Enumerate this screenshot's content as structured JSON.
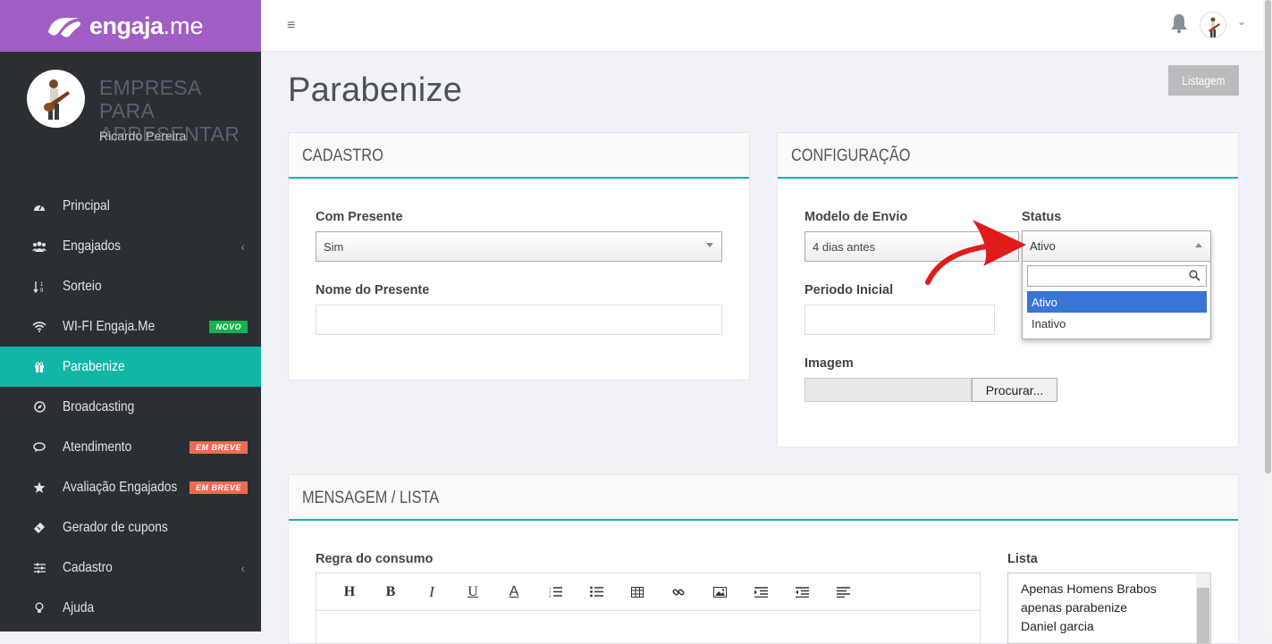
{
  "brand": {
    "name_bold": "engaja",
    "name_rest": ".me",
    "color": "#a05ec5"
  },
  "profile": {
    "company": "EMPRESA PARA APRESENTAR",
    "user": "Ricardo Pereira"
  },
  "nav": {
    "items": [
      {
        "label": "Principal",
        "icon": "dashboard-icon"
      },
      {
        "label": "Engajados",
        "icon": "users-icon",
        "chevron": "‹"
      },
      {
        "label": "Sorteio",
        "icon": "sort-numeric-icon"
      },
      {
        "label": "WI-FI Engaja.Me",
        "icon": "wifi-icon",
        "badge": "NOVO"
      },
      {
        "label": "Parabenize",
        "icon": "gift-icon",
        "active": true
      },
      {
        "label": "Broadcasting",
        "icon": "compass-icon"
      },
      {
        "label": "Atendimento",
        "icon": "chat-icon",
        "badge": "EM BREVE"
      },
      {
        "label": "Avaliação Engajados",
        "icon": "star-icon",
        "badge": "EM BREVE"
      },
      {
        "label": "Gerador de cupons",
        "icon": "ticket-icon"
      },
      {
        "label": "Cadastro",
        "icon": "sliders-icon",
        "chevron": "‹"
      },
      {
        "label": "Ajuda",
        "icon": "lightbulb-icon"
      }
    ],
    "active_color": "#12b5a7"
  },
  "topbar": {
    "menu_glyph": "≡",
    "user_chevron": "⌄"
  },
  "page": {
    "title": "Parabenize",
    "listagem_button": "Listagem"
  },
  "cadastro": {
    "header": "CADASTRO",
    "com_presente_label": "Com Presente",
    "com_presente_value": "Sim",
    "nome_presente_label": "Nome do Presente",
    "nome_presente_value": ""
  },
  "configuracao": {
    "header": "CONFIGURAÇÃO",
    "modelo_label": "Modelo de Envio",
    "modelo_value": "4 dias antes",
    "status_label": "Status",
    "status_value": "Ativo",
    "status_options": [
      "Ativo",
      "Inativo"
    ],
    "periodo_label": "Periodo Inicial",
    "imagem_label": "Imagem",
    "procurar_button": "Procurar..."
  },
  "mensagem": {
    "header": "MENSAGEM / LISTA",
    "regra_label": "Regra do consumo",
    "toolbar": [
      "H",
      "B",
      "I",
      "U",
      "A",
      "ordered-list-icon",
      "unordered-list-icon",
      "table-icon",
      "link-icon",
      "image-icon",
      "indent-icon",
      "outdent-icon",
      "align-icon"
    ],
    "lista_label": "Lista",
    "lista_items": [
      "Apenas Homens Brabos",
      "apenas parabenize",
      "Daniel garcia"
    ]
  }
}
